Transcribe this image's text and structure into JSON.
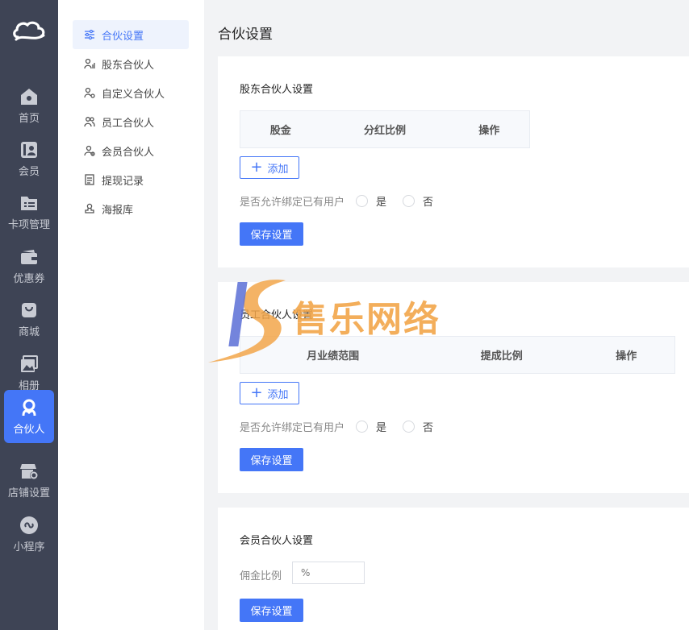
{
  "rail": {
    "items": [
      {
        "label": "首页",
        "icon": "home-icon"
      },
      {
        "label": "会员",
        "icon": "member-card-icon"
      },
      {
        "label": "卡项管理",
        "icon": "folder-list-icon"
      },
      {
        "label": "优惠券",
        "icon": "wallet-icon"
      },
      {
        "label": "商城",
        "icon": "shopping-bag-icon"
      },
      {
        "label": "相册",
        "icon": "photo-icon"
      },
      {
        "label": "合伙人",
        "icon": "partner-icon"
      },
      {
        "label": "店铺设置",
        "icon": "shop-settings-icon"
      },
      {
        "label": "小程序",
        "icon": "mini-program-icon"
      }
    ],
    "active_index": 6
  },
  "submenu": {
    "items": [
      {
        "label": "合伙设置",
        "icon": "sliders-icon"
      },
      {
        "label": "股东合伙人",
        "icon": "shareholder-icon"
      },
      {
        "label": "自定义合伙人",
        "icon": "custom-user-icon"
      },
      {
        "label": "员工合伙人",
        "icon": "staff-icon"
      },
      {
        "label": "会员合伙人",
        "icon": "member-user-icon"
      },
      {
        "label": "提现记录",
        "icon": "document-icon"
      },
      {
        "label": "海报库",
        "icon": "stamp-icon"
      }
    ],
    "active_index": 0
  },
  "page_title": "合伙设置",
  "shareholder": {
    "title": "股东合伙人设置",
    "columns": [
      "股金",
      "分红比例",
      "操作"
    ],
    "add_label": "添加",
    "bind_question": "是否允许绑定已有用户",
    "yes": "是",
    "no": "否",
    "save_label": "保存设置"
  },
  "staff": {
    "title": "员工合伙人设置",
    "columns": [
      "月业绩范围",
      "提成比例",
      "操作"
    ],
    "add_label": "添加",
    "bind_question": "是否允许绑定已有用户",
    "yes": "是",
    "no": "否",
    "save_label": "保存设置"
  },
  "member": {
    "title": "会员合伙人设置",
    "commission_label": "佣金比例",
    "commission_placeholder": "%",
    "save_label": "保存设置"
  },
  "watermark": {
    "text": "售乐网络"
  },
  "colors": {
    "rail_bg": "#3e4455",
    "accent": "#4476f7",
    "watermark_orange": "#f2a64a",
    "watermark_blue": "#5b6fd6"
  }
}
